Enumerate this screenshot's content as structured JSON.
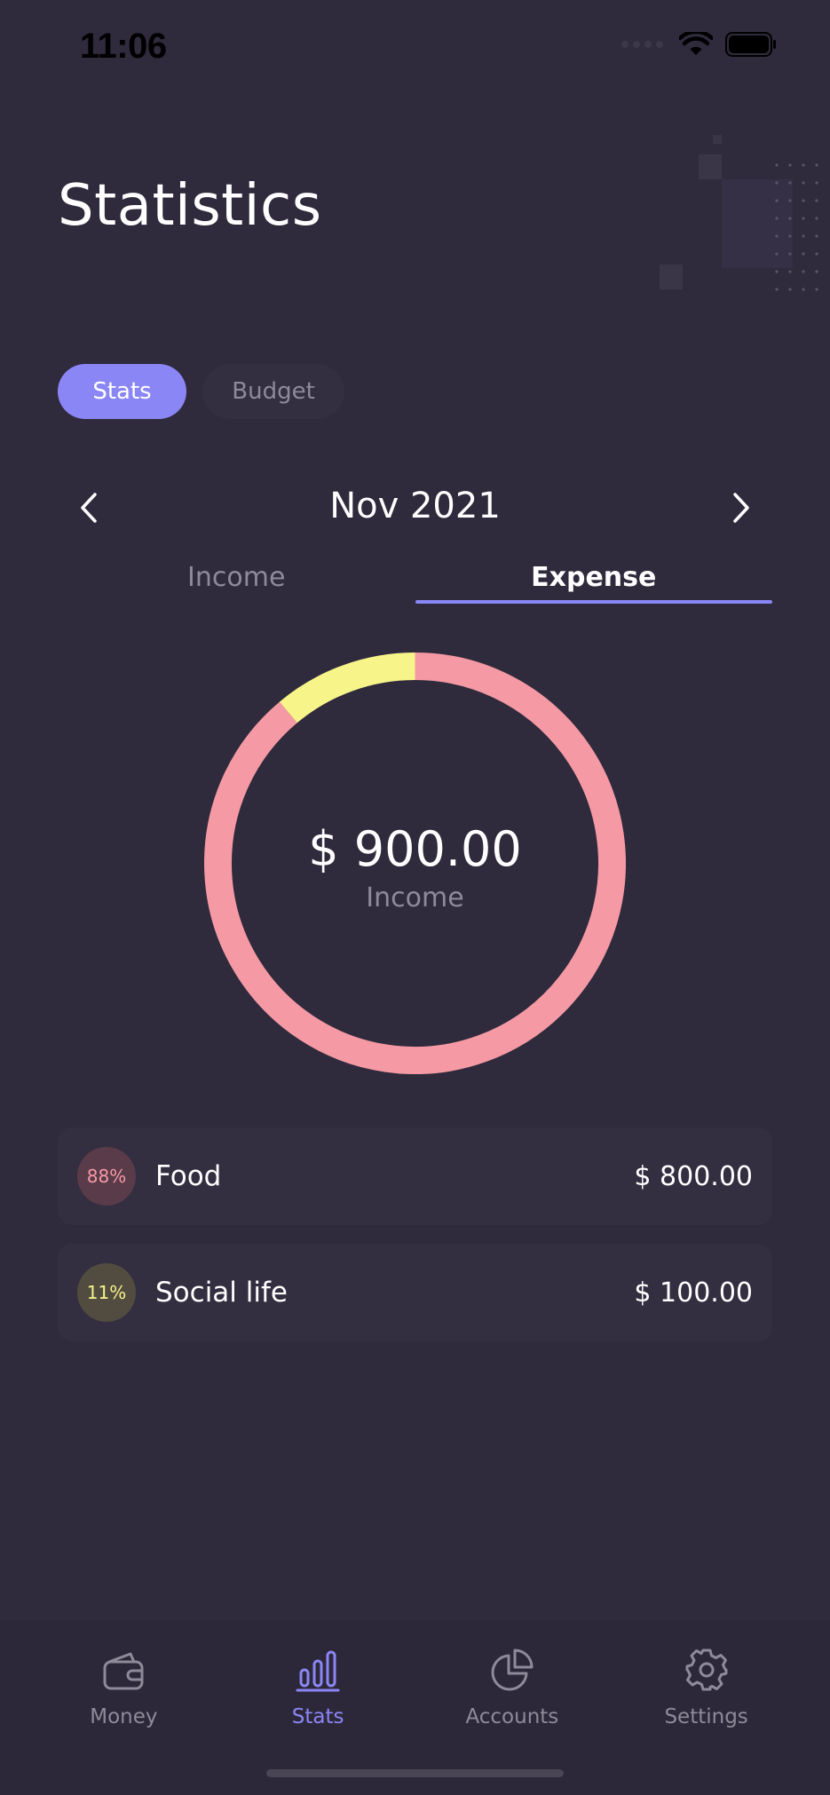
{
  "status_bar": {
    "time": "11:06"
  },
  "header": {
    "title": "Statistics"
  },
  "segments": [
    {
      "label": "Stats",
      "active": true
    },
    {
      "label": "Budget",
      "active": false
    }
  ],
  "period": {
    "label": "Nov 2021"
  },
  "type_tabs": [
    {
      "label": "Income",
      "active": false
    },
    {
      "label": "Expense",
      "active": true
    }
  ],
  "summary": {
    "amount": "$ 900.00",
    "label": "Income"
  },
  "chart_data": {
    "type": "pie",
    "categories": [
      "Food",
      "Social life"
    ],
    "values": [
      800,
      100
    ],
    "colors": [
      "#f59aa4",
      "#f7f48a"
    ]
  },
  "categories": [
    {
      "percent": "88%",
      "name": "Food",
      "amount": "$ 800.00",
      "badge_bg": "#5a3b4a",
      "badge_color": "#f59aa4"
    },
    {
      "percent": "11%",
      "name": "Social life",
      "amount": "$ 100.00",
      "badge_bg": "#524c40",
      "badge_color": "#f7f48a"
    }
  ],
  "bottom_nav": [
    {
      "label": "Money",
      "icon": "wallet-icon",
      "active": false
    },
    {
      "label": "Stats",
      "icon": "bar-chart-icon",
      "active": true
    },
    {
      "label": "Accounts",
      "icon": "pie-chart-icon",
      "active": false
    },
    {
      "label": "Settings",
      "icon": "gear-icon",
      "active": false
    }
  ],
  "colors": {
    "background": "#2f2a3c",
    "accent": "#8b86f5",
    "card": "#332e40",
    "muted_text": "#8e8a99"
  }
}
